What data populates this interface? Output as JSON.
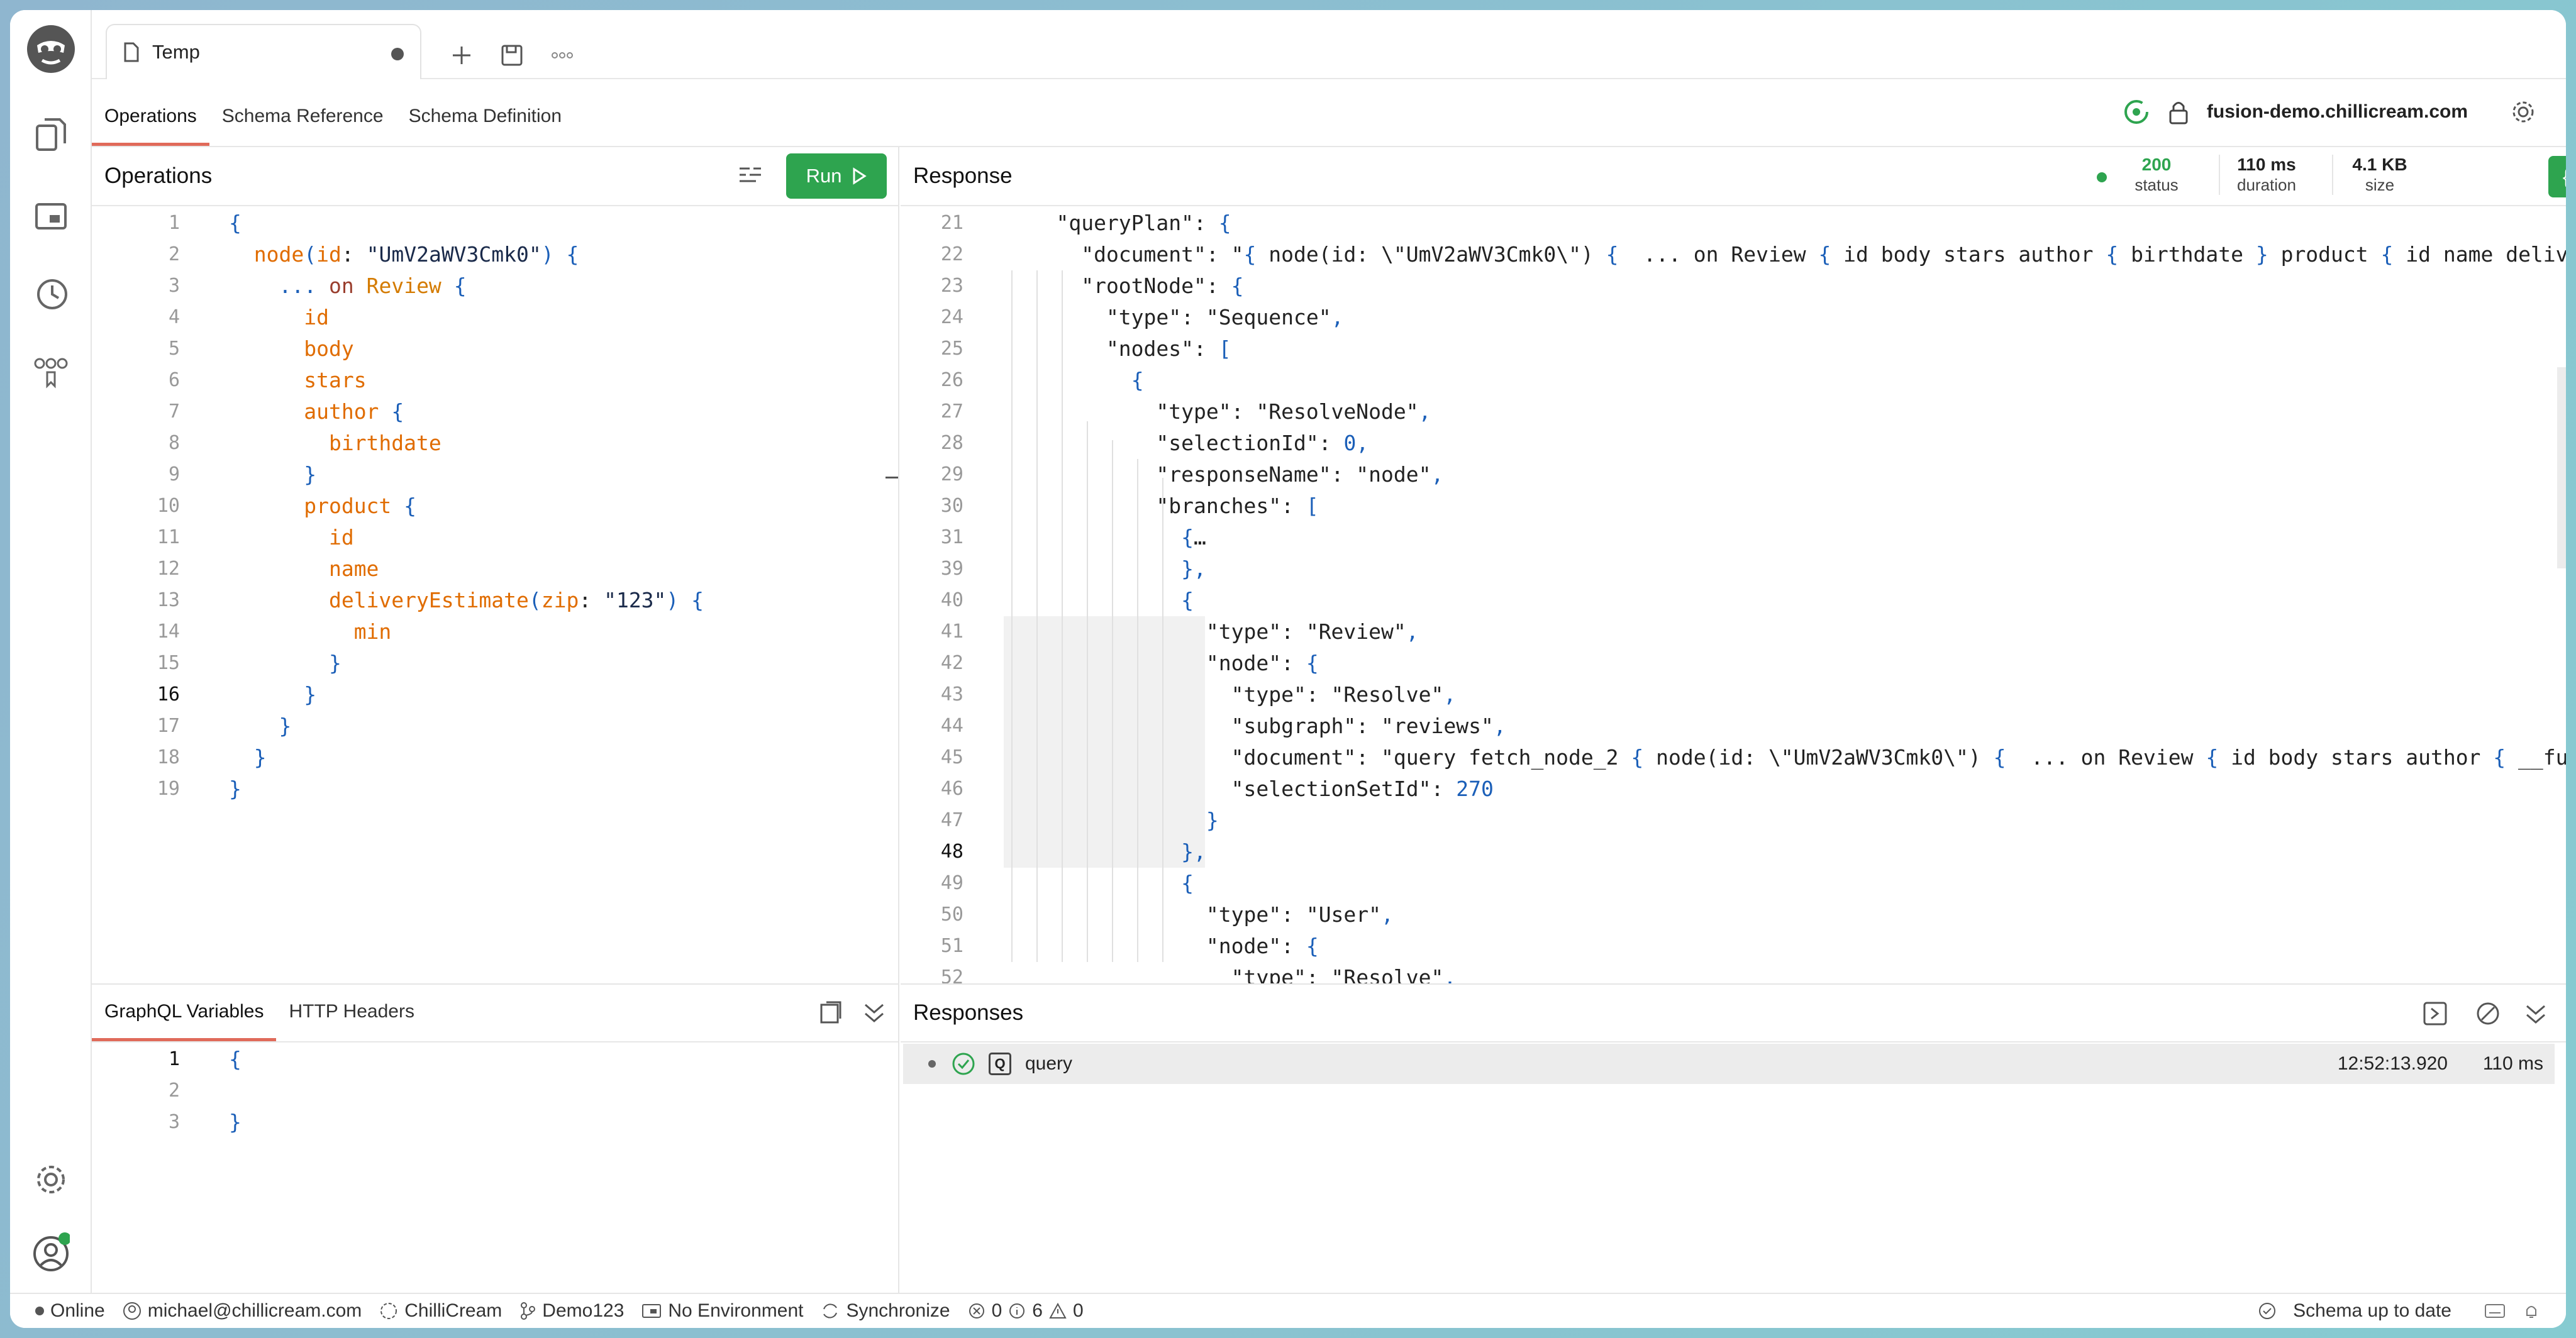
{
  "tab": {
    "title": "Temp"
  },
  "subtabs": [
    "Operations",
    "Schema Reference",
    "Schema Definition"
  ],
  "endpoint": "fusion-demo.chillicream.com",
  "ops": {
    "title": "Operations",
    "run": "Run",
    "lines": [
      "{",
      "  node(id: \"UmV2aWV3Cmk0\") {",
      "    ... on Review {",
      "      id",
      "      body",
      "      stars",
      "      author {",
      "        birthdate",
      "      }",
      "      product {",
      "        id",
      "        name",
      "        deliveryEstimate(zip: \"123\") {",
      "          min",
      "        }",
      "      }",
      "    }",
      "  }",
      "}"
    ]
  },
  "response": {
    "title": "Response",
    "stats": [
      {
        "v": "200",
        "l": "status"
      },
      {
        "v": "110 ms",
        "l": "duration"
      },
      {
        "v": "4.1 KB",
        "l": "size"
      }
    ],
    "nums": [
      "21",
      "22",
      "23",
      "24",
      "25",
      "26",
      "27",
      "28",
      "29",
      "30",
      "31",
      "39",
      "40",
      "41",
      "42",
      "43",
      "44",
      "45",
      "46",
      "47",
      "48",
      "49",
      "50",
      "51",
      "52"
    ],
    "lines": [
      "    \"queryPlan\": {",
      "      \"document\": \"{ node(id: \\\"UmV2aWV3Cmk0\\\") {  ... on Review { id body stars author { birthdate } product { id name delive",
      "      \"rootNode\": {",
      "        \"type\": \"Sequence\",",
      "        \"nodes\": [",
      "          {",
      "            \"type\": \"ResolveNode\",",
      "            \"selectionId\": 0,",
      "            \"responseName\": \"node\",",
      "            \"branches\": [",
      "              {…",
      "              },",
      "              {",
      "                \"type\": \"Review\",",
      "                \"node\": {",
      "                  \"type\": \"Resolve\",",
      "                  \"subgraph\": \"reviews\",",
      "                  \"document\": \"query fetch_node_2 { node(id: \\\"UmV2aWV3Cmk0\\\") {  ... on Review { id body stars author { __fus",
      "                  \"selectionSetId\": 270",
      "                }",
      "              },",
      "              {",
      "                \"type\": \"User\",",
      "                \"node\": {",
      "                  \"type\": \"Resolve\","
    ]
  },
  "vars": {
    "tabs": [
      "GraphQL Variables",
      "HTTP Headers"
    ],
    "lines": [
      "{",
      "",
      "}"
    ]
  },
  "responses": {
    "title": "Responses",
    "item": {
      "label": "query",
      "time": "12:52:13.920",
      "dur": "110 ms"
    }
  },
  "status": {
    "online": "Online",
    "user": "michael@chillicream.com",
    "org": "ChilliCream",
    "branch": "Demo123",
    "env": "No Environment",
    "sync": "Synchronize",
    "errors": "0",
    "infos": "6",
    "warnings": "0",
    "schema": "Schema up to date"
  }
}
